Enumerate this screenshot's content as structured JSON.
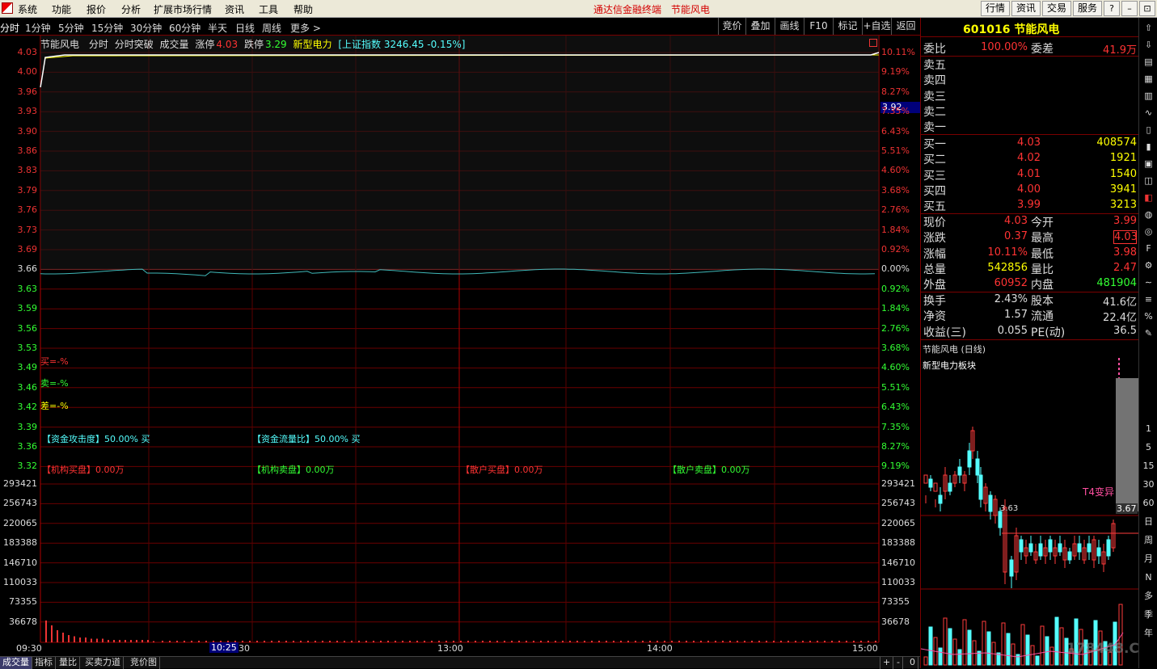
{
  "menu": {
    "items": [
      "系统",
      "功能",
      "报价",
      "分析",
      "扩展市场行情",
      "资讯",
      "工具",
      "帮助"
    ],
    "app_title": "通达信金融终端",
    "stock_title": "节能风电",
    "right_buttons": [
      "行情",
      "资讯",
      "交易",
      "服务"
    ],
    "window_buttons": [
      "?",
      "–",
      "⊡",
      "✕"
    ]
  },
  "periods": {
    "items": [
      "分时",
      "1分钟",
      "5分钟",
      "15分钟",
      "30分钟",
      "60分钟",
      "半天",
      "日线",
      "周线",
      "更多 >"
    ],
    "tools": [
      "竞价",
      "叠加",
      "画线",
      "F10",
      "标记",
      "+自选",
      "返回"
    ]
  },
  "chart_info": {
    "name": "节能风电",
    "mode": "分时",
    "indicator": "分时突破",
    "volume_label": "成交量",
    "limit_up_label": "涨停",
    "limit_up": "4.03",
    "limit_down_label": "跌停",
    "limit_down": "3.29",
    "sector": "新型电力",
    "index_info": "[上证指数 3246.45 -0.15%]"
  },
  "price_axis": {
    "left": [
      "4.03",
      "4.00",
      "3.96",
      "3.93",
      "3.90",
      "3.86",
      "3.83",
      "3.79",
      "3.76",
      "3.73",
      "3.69",
      "3.66",
      "3.63",
      "3.59",
      "3.56",
      "3.53",
      "3.49",
      "3.46",
      "3.42",
      "3.39",
      "3.36",
      "3.32"
    ],
    "right": [
      "10.11%",
      "9.19%",
      "8.27%",
      "7.35%",
      "6.43%",
      "5.51%",
      "4.60%",
      "3.68%",
      "2.76%",
      "1.84%",
      "0.92%",
      "0.00%",
      "0.92%",
      "1.84%",
      "2.76%",
      "3.68%",
      "4.60%",
      "5.51%",
      "6.43%",
      "7.35%",
      "8.27%",
      "9.19%"
    ],
    "current_price_tag": "3.92"
  },
  "volume_axis": [
    "293421",
    "256743",
    "220065",
    "183388",
    "146710",
    "110033",
    "73355",
    "36678"
  ],
  "time_axis": [
    "09:30",
    "10:25",
    "30",
    "13:00",
    "14:00",
    "15:00"
  ],
  "indicators": {
    "buy": "买=-%",
    "sell": "卖=-%",
    "diff": "差=-%",
    "attack": "【资金攻击度】50.00% 买",
    "flow": "【资金流量比】50.00% 买",
    "inst_buy": "【机构买盘】0.00万",
    "inst_sell": "【机构卖盘】0.00万",
    "retail_buy": "【散户买盘】0.00万",
    "retail_sell": "【散户卖盘】0.00万"
  },
  "quote": {
    "code_name": "601016 节能风电",
    "weibi_label": "委比",
    "weibi": "100.00%",
    "weicha_label": "委差",
    "weicha": "41.9万",
    "asks": [
      {
        "label": "卖五",
        "price": "",
        "vol": ""
      },
      {
        "label": "卖四",
        "price": "",
        "vol": ""
      },
      {
        "label": "卖三",
        "price": "",
        "vol": ""
      },
      {
        "label": "卖二",
        "price": "",
        "vol": ""
      },
      {
        "label": "卖一",
        "price": "",
        "vol": ""
      }
    ],
    "bids": [
      {
        "label": "买一",
        "price": "4.03",
        "vol": "408574"
      },
      {
        "label": "买二",
        "price": "4.02",
        "vol": "1921"
      },
      {
        "label": "买三",
        "price": "4.01",
        "vol": "1540"
      },
      {
        "label": "买四",
        "price": "4.00",
        "vol": "3941"
      },
      {
        "label": "买五",
        "price": "3.99",
        "vol": "3213"
      }
    ],
    "stats": [
      {
        "l1": "现价",
        "v1": "4.03",
        "l2": "今开",
        "v2": "3.99"
      },
      {
        "l1": "涨跌",
        "v1": "0.37",
        "l2": "最高",
        "v2": "4.03"
      },
      {
        "l1": "涨幅",
        "v1": "10.11%",
        "l2": "最低",
        "v2": "3.98"
      },
      {
        "l1": "总量",
        "v1": "542856",
        "l2": "量比",
        "v2": "2.47"
      },
      {
        "l1": "外盘",
        "v1": "60952",
        "l2": "内盘",
        "v2": "481904"
      }
    ],
    "stats2": [
      {
        "l1": "换手",
        "v1": "2.43%",
        "l2": "股本",
        "v2": "41.6亿"
      },
      {
        "l1": "净资",
        "v1": "1.57",
        "l2": "流通",
        "v2": "22.4亿"
      },
      {
        "l1": "收益(三)",
        "v1": "0.055",
        "l2": "PE(动)",
        "v2": "36.5"
      }
    ]
  },
  "mini_chart": {
    "title": "节能风电 (日线)",
    "sector": "新型电力板块",
    "price_low_label": "3.63",
    "price_now_label": "3.67",
    "annotation": "T4变异"
  },
  "right_toolbar": [
    "1",
    "5",
    "15",
    "30",
    "60",
    "日",
    "周",
    "月",
    "N",
    "多",
    "季",
    "年"
  ],
  "bottom_tabs": [
    "成交量",
    "指标",
    "量比",
    "买卖力道",
    "竞价图"
  ],
  "bottom_right": [
    "+",
    "-",
    "0"
  ],
  "watermark": "178448.COM",
  "colors": {
    "up": "#ff3b3b",
    "down": "#54ffff",
    "grid": "#8a0000",
    "price_line": "#ffffff",
    "avg_line": "#ffff00"
  }
}
